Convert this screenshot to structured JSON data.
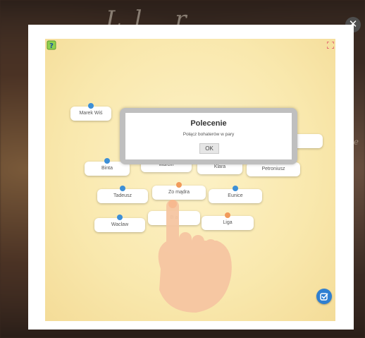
{
  "background": {
    "script_text": "Ll r",
    "side_left": "",
    "side_right": "ie"
  },
  "modal": {
    "close_label": "✕",
    "icons": {
      "help": "help-question-icon",
      "fullscreen": "fullscreen-icon",
      "check": "check-icon"
    }
  },
  "dialog": {
    "title": "Polecenie",
    "message": "Połącz bohaterów w pary",
    "ok_label": "OK"
  },
  "cards": [
    {
      "label": "Marek Wiś",
      "dot": "blue"
    },
    {
      "label": "",
      "dot": "none"
    },
    {
      "label": "Binta",
      "dot": "blue"
    },
    {
      "label": "Marcin",
      "dot": "orange"
    },
    {
      "label": "Klara",
      "dot": "orange"
    },
    {
      "label": "Petroniusz",
      "dot": "orange"
    },
    {
      "label": "Tadeusz",
      "dot": "blue"
    },
    {
      "label": "Zo     mądra",
      "dot": "orange"
    },
    {
      "label": "Eunice",
      "dot": "blue"
    },
    {
      "label": "B      a",
      "dot": "none"
    },
    {
      "label": "Waclaw",
      "dot": "blue"
    },
    {
      "label": "Liga",
      "dot": "orange"
    }
  ],
  "colors": {
    "board": "#f9e8ad",
    "blue_dot": "#3d8fd6",
    "orange_dot": "#f19a5a",
    "check_btn": "#2f7fd1"
  }
}
